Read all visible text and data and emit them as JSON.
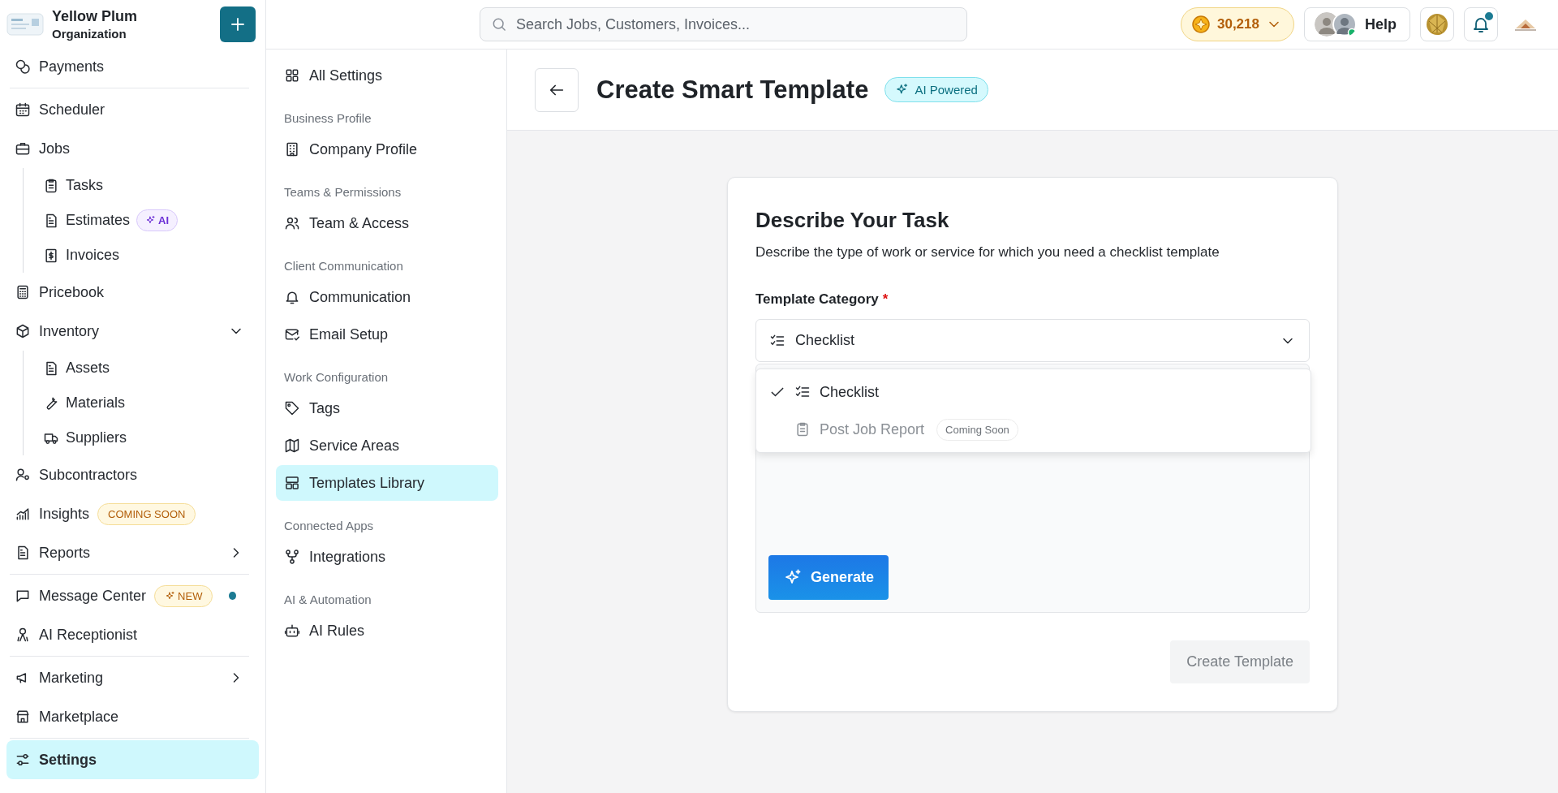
{
  "sidebar": {
    "org": {
      "name": "Yellow Plum",
      "subtitle": "Organization"
    },
    "groups": [
      [
        {
          "label": "Payments",
          "selected": false
        }
      ],
      [
        {
          "label": "Scheduler",
          "selected": false
        },
        {
          "label": "Jobs",
          "selected": false,
          "children": [
            {
              "label": "Tasks",
              "selected": false
            },
            {
              "label": "Estimates",
              "selected": false,
              "badge": {
                "text": "AI",
                "kind": "ai"
              }
            },
            {
              "label": "Invoices",
              "selected": false
            }
          ]
        },
        {
          "label": "Pricebook",
          "selected": false
        },
        {
          "label": "Inventory",
          "selected": false,
          "expanded": true,
          "children": [
            {
              "label": "Assets",
              "selected": false
            },
            {
              "label": "Materials",
              "selected": false
            },
            {
              "label": "Suppliers",
              "selected": false
            }
          ]
        },
        {
          "label": "Subcontractors",
          "selected": false
        },
        {
          "label": "Insights",
          "selected": false,
          "badge": {
            "text": "COMING SOON",
            "kind": "soon"
          }
        },
        {
          "label": "Reports",
          "selected": false,
          "expanded": false
        }
      ],
      [
        {
          "label": "Message Center",
          "selected": false,
          "badge": {
            "text": "NEW",
            "kind": "new"
          },
          "unread": true
        },
        {
          "label": "AI Receptionist",
          "selected": false
        }
      ],
      [
        {
          "label": "Marketing",
          "selected": false,
          "expanded": false
        },
        {
          "label": "Marketplace",
          "selected": false
        }
      ],
      [
        {
          "label": "Settings",
          "selected": true
        }
      ]
    ]
  },
  "topbar": {
    "search": {
      "placeholder": "Search Jobs, Customers, Invoices..."
    },
    "points": "30,218",
    "help": "Help",
    "notifications": true
  },
  "settings_nav": {
    "all": {
      "label": "All Settings",
      "selected": false
    },
    "sections": [
      {
        "heading": "Business Profile",
        "items": [
          {
            "label": "Company Profile",
            "selected": false
          }
        ]
      },
      {
        "heading": "Teams & Permissions",
        "items": [
          {
            "label": "Team & Access",
            "selected": false
          }
        ]
      },
      {
        "heading": "Client Communication",
        "items": [
          {
            "label": "Communication",
            "selected": false
          },
          {
            "label": "Email Setup",
            "selected": false
          }
        ]
      },
      {
        "heading": "Work Configuration",
        "items": [
          {
            "label": "Tags",
            "selected": false
          },
          {
            "label": "Service Areas",
            "selected": false
          },
          {
            "label": "Templates Library",
            "selected": true
          }
        ]
      },
      {
        "heading": "Connected Apps",
        "items": [
          {
            "label": "Integrations",
            "selected": false
          }
        ]
      },
      {
        "heading": "AI & Automation",
        "items": [
          {
            "label": "AI Rules",
            "selected": false
          }
        ]
      }
    ]
  },
  "page": {
    "title": "Create Smart Template",
    "badge": "AI Powered"
  },
  "card": {
    "heading": "Describe Your Task",
    "description": "Describe the type of work or service for which you need a checklist template",
    "field": {
      "label": "Template Category",
      "required_mark": "*",
      "value": "Checklist",
      "options": [
        {
          "label": "Checklist",
          "selected": true,
          "disabled": false
        },
        {
          "label": "Post Job Report",
          "selected": false,
          "disabled": true,
          "badge": "Coming Soon"
        }
      ]
    },
    "generate": "Generate",
    "create": {
      "label": "Create Template",
      "disabled": true
    }
  }
}
